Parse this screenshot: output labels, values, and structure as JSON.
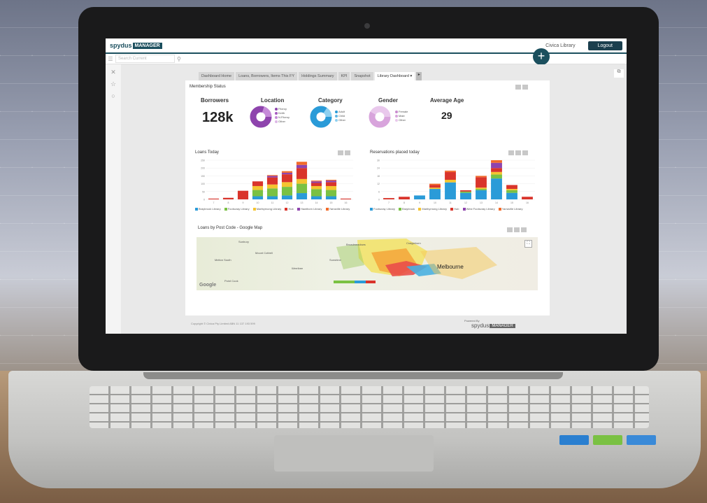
{
  "header": {
    "brand": "spydus",
    "brand_badge": "MANAGER",
    "library_name": "Civica Library",
    "logout_label": "Logout",
    "add_label": "+"
  },
  "search": {
    "placeholder": "Search Current"
  },
  "tabs": [
    {
      "label": "Dashboard Home"
    },
    {
      "label": "Loans, Borrowers, Items This FY"
    },
    {
      "label": "Holdings Summary"
    },
    {
      "label": "KPI"
    },
    {
      "label": "Snapshot"
    },
    {
      "label": "Library Dashboard ▾"
    }
  ],
  "membership": {
    "title": "Membership Status",
    "borrowers": {
      "label": "Borrowers",
      "value": "128k"
    },
    "location": {
      "label": "Location",
      "legend": [
        "Fitzroy",
        "Keith",
        "N.Fitzroy",
        "Other"
      ]
    },
    "category": {
      "label": "Category",
      "legend": [
        "Adult",
        "Child",
        "Other"
      ]
    },
    "gender": {
      "label": "Gender",
      "legend": [
        "Female",
        "Male",
        "Other"
      ]
    },
    "average_age": {
      "label": "Average Age",
      "value": "29"
    }
  },
  "loans_today": {
    "title": "Loans Today",
    "legend": [
      "Braybrook Library",
      "Footscray Library",
      "Maribyrnong Library",
      "Hub",
      "Hawthorn Library",
      "Yarraville Library"
    ]
  },
  "reservations": {
    "title": "Reservations placed today",
    "legend": [
      "Footscray Library",
      "Braybrook",
      "Maribyrnong Library",
      "Hub",
      "West Footscray Library",
      "Yarraville Library"
    ]
  },
  "map": {
    "title": "Loans by Post Code - Google Map",
    "city": "Melbourne",
    "google": "Google",
    "labels": [
      "Sunbury",
      "Broadmeadows",
      "Mount Cottrell",
      "Melton South",
      "Craigieburn",
      "Werribee",
      "Sunshine",
      "Point Cook"
    ]
  },
  "footer": {
    "copyright": "Copyright © Civica Pty Limited ABN 11 137 193 599",
    "powered_by": "Powered By",
    "brand": "spydus",
    "brand_badge": "MANAGER"
  },
  "colors": {
    "brand": "#1b4f5e",
    "blue": "#2a9bd8",
    "green": "#7ac143",
    "yellow": "#f4c430",
    "red": "#d9342b",
    "purple": "#8e44ad",
    "orange": "#f26b2a"
  },
  "chart_data": [
    {
      "type": "bar",
      "title": "Loans Today",
      "categories": [
        "7",
        "8",
        "9",
        "10",
        "11",
        "12",
        "13",
        "14",
        "15",
        "16"
      ],
      "ylim": [
        0,
        250
      ],
      "series": [
        {
          "name": "Braybrook Library",
          "values": [
            0,
            0,
            0,
            20,
            20,
            25,
            40,
            20,
            20,
            0
          ]
        },
        {
          "name": "Footscray Library",
          "values": [
            0,
            0,
            0,
            40,
            50,
            55,
            60,
            45,
            40,
            0
          ]
        },
        {
          "name": "Maribyrnong Library",
          "values": [
            0,
            0,
            0,
            25,
            25,
            30,
            30,
            20,
            25,
            0
          ]
        },
        {
          "name": "Hub",
          "values": [
            5,
            10,
            55,
            30,
            45,
            50,
            70,
            20,
            25,
            5
          ]
        },
        {
          "name": "Hawthorn Library",
          "values": [
            0,
            0,
            0,
            0,
            10,
            10,
            20,
            10,
            10,
            0
          ]
        },
        {
          "name": "Yarraville Library",
          "values": [
            0,
            0,
            0,
            0,
            5,
            10,
            20,
            5,
            5,
            0
          ]
        }
      ]
    },
    {
      "type": "bar",
      "title": "Reservations placed today",
      "categories": [
        "7",
        "8",
        "9",
        "10",
        "11",
        "12",
        "13",
        "14",
        "15",
        "16"
      ],
      "ylim": [
        0,
        30
      ],
      "series": [
        {
          "name": "Footscray Library",
          "values": [
            0,
            0,
            3,
            8,
            13,
            5,
            7,
            16,
            5,
            0
          ]
        },
        {
          "name": "Braybrook",
          "values": [
            0,
            0,
            0,
            0,
            0,
            1,
            1,
            3,
            2,
            0
          ]
        },
        {
          "name": "Maribyrnong Library",
          "values": [
            0,
            0,
            0,
            1,
            2,
            0,
            1,
            2,
            1,
            0
          ]
        },
        {
          "name": "Hub",
          "values": [
            1,
            2,
            0,
            2,
            6,
            1,
            8,
            3,
            3,
            2
          ]
        },
        {
          "name": "West Footscray Library",
          "values": [
            0,
            0,
            0,
            0,
            0,
            0,
            0,
            4,
            0,
            0
          ]
        },
        {
          "name": "Yarraville Library",
          "values": [
            0,
            0,
            0,
            1,
            1,
            0,
            1,
            2,
            0,
            0
          ]
        }
      ]
    }
  ]
}
